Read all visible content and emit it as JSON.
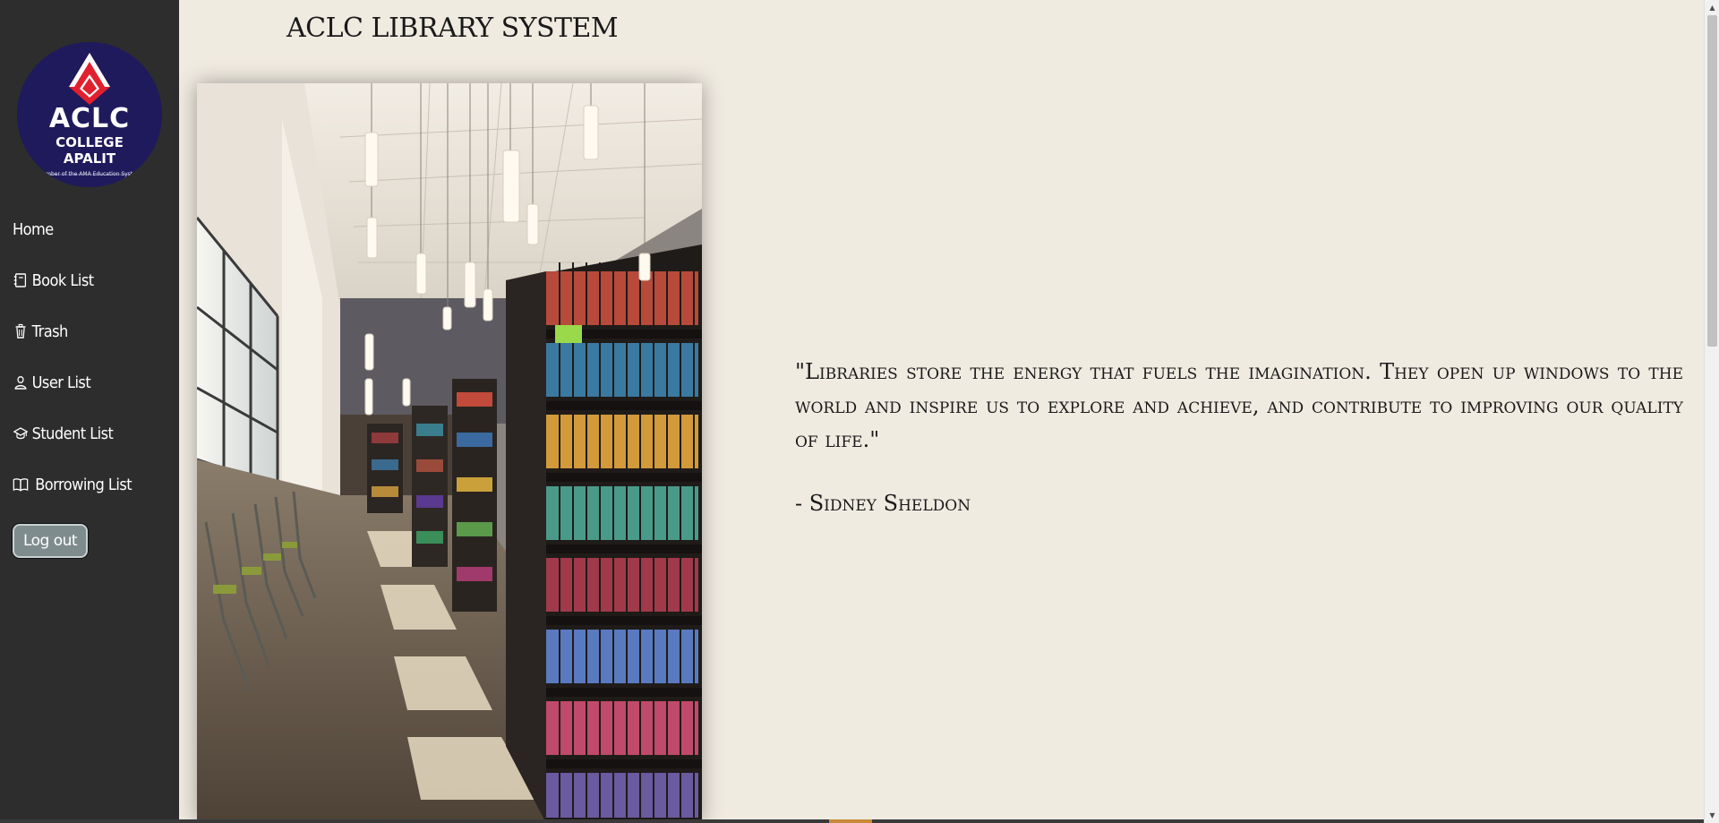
{
  "app": {
    "title": "ACLC LIBRARY SYSTEM"
  },
  "logo": {
    "line1": "ACLC",
    "line2": "COLLEGE",
    "line3": "APALIT",
    "line4": "Member of the AMA Education System",
    "colors": {
      "background": "#1e1a5c",
      "diamond": "#e0202e"
    }
  },
  "sidebar": {
    "items": [
      {
        "label": "Home",
        "icon": "none"
      },
      {
        "label": "Book List",
        "icon": "notebook-icon"
      },
      {
        "label": "Trash",
        "icon": "trash-icon"
      },
      {
        "label": "User List",
        "icon": "person-icon"
      },
      {
        "label": "Student List",
        "icon": "graduation-cap-icon"
      },
      {
        "label": "Borrowing List",
        "icon": "open-book-icon"
      }
    ],
    "logout_label": "Log out"
  },
  "main": {
    "image_alt": "Library aisle with bookshelves and pendant lights",
    "quote": "\"Libraries store the energy that fuels the imagination. They open up windows to the world and inspire us to explore and achieve, and contribute to improving our quality of life.\"",
    "author": "- Sidney Sheldon"
  },
  "colors": {
    "sidebar": "#2d2d2d",
    "page_background": "#f0ebe1",
    "logout_button": "#7f8c8d"
  }
}
